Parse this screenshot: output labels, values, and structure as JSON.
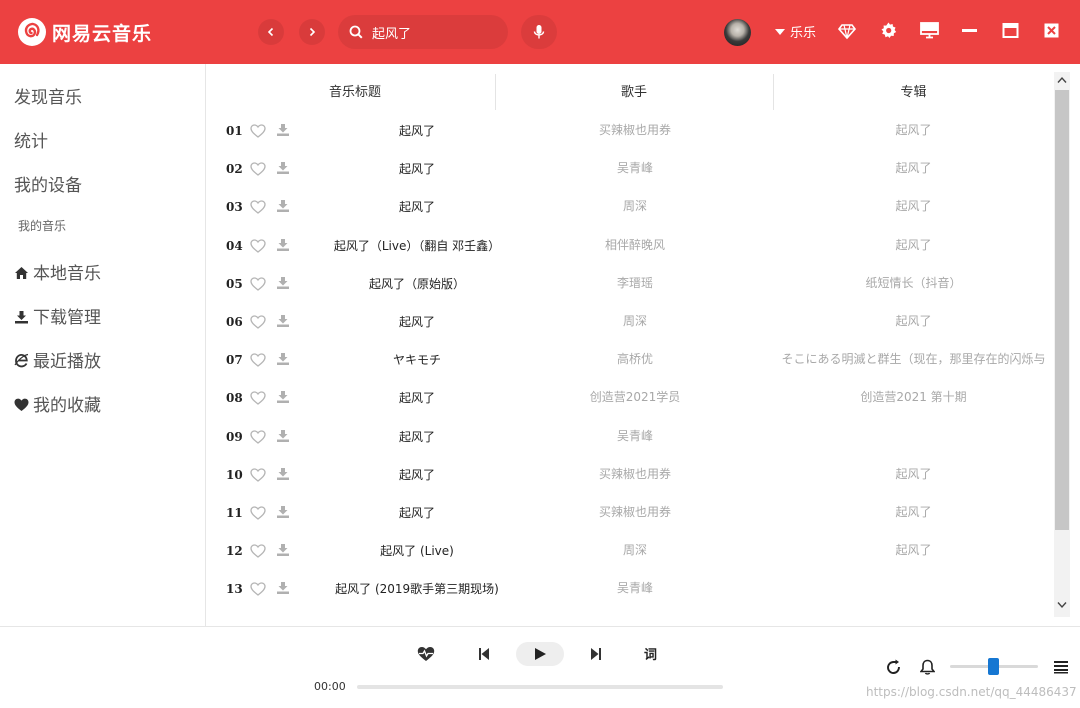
{
  "app": {
    "name": "网易云音乐",
    "brand_color": "#ec4141"
  },
  "header": {
    "search_value": "起风了",
    "user_name": "乐乐",
    "icons": [
      "back-icon",
      "forward-icon",
      "search-icon",
      "mic-icon",
      "vip-diamond-icon",
      "gear-icon",
      "monitor-icon",
      "minimize-icon",
      "maximize-icon",
      "close-icon"
    ]
  },
  "sidebar": {
    "discover": "发现音乐",
    "stats": "统计",
    "devices": "我的设备",
    "my_music_label": "我的音乐",
    "local": "本地音乐",
    "downloads": "下载管理",
    "recent": "最近播放",
    "favorites": "我的收藏"
  },
  "table": {
    "headers": {
      "title": "音乐标题",
      "artist": "歌手",
      "album": "专辑"
    },
    "rows": [
      {
        "num": "01",
        "title": "起风了",
        "artist": "买辣椒也用券",
        "album": "起风了"
      },
      {
        "num": "02",
        "title": "起风了",
        "artist": "吴青峰",
        "album": "起风了"
      },
      {
        "num": "03",
        "title": "起风了",
        "artist": "周深",
        "album": "起风了"
      },
      {
        "num": "04",
        "title": "起风了（Live）（翻自 邓壬鑫）",
        "artist": "相伴醉晚风",
        "album": "起风了"
      },
      {
        "num": "05",
        "title": "起风了（原始版）",
        "artist": "李瑨瑶",
        "album": "纸短情长（抖音）"
      },
      {
        "num": "06",
        "title": "起风了",
        "artist": "周深",
        "album": "起风了"
      },
      {
        "num": "07",
        "title": "ヤキモチ",
        "artist": "高桥优",
        "album": "そこにある明滅と群生（现在，那里存在的闪烁与"
      },
      {
        "num": "08",
        "title": "起风了",
        "artist": "创造营2021学员",
        "album": "创造营2021 第十期"
      },
      {
        "num": "09",
        "title": "起风了",
        "artist": "吴青峰",
        "album": ""
      },
      {
        "num": "10",
        "title": "起风了",
        "artist": "买辣椒也用券",
        "album": "起风了"
      },
      {
        "num": "11",
        "title": "起风了",
        "artist": "买辣椒也用券",
        "album": "起风了"
      },
      {
        "num": "12",
        "title": "起风了 (Live)",
        "artist": "周深",
        "album": "起风了"
      },
      {
        "num": "13",
        "title": "起风了 (2019歌手第三期现场)",
        "artist": "吴青峰",
        "album": ""
      }
    ]
  },
  "player": {
    "time": "00:00",
    "lyric_label": "词",
    "progress_fraction": 0,
    "volume_fraction": 0.5
  },
  "watermark": "https://blog.csdn.net/qq_44486437"
}
